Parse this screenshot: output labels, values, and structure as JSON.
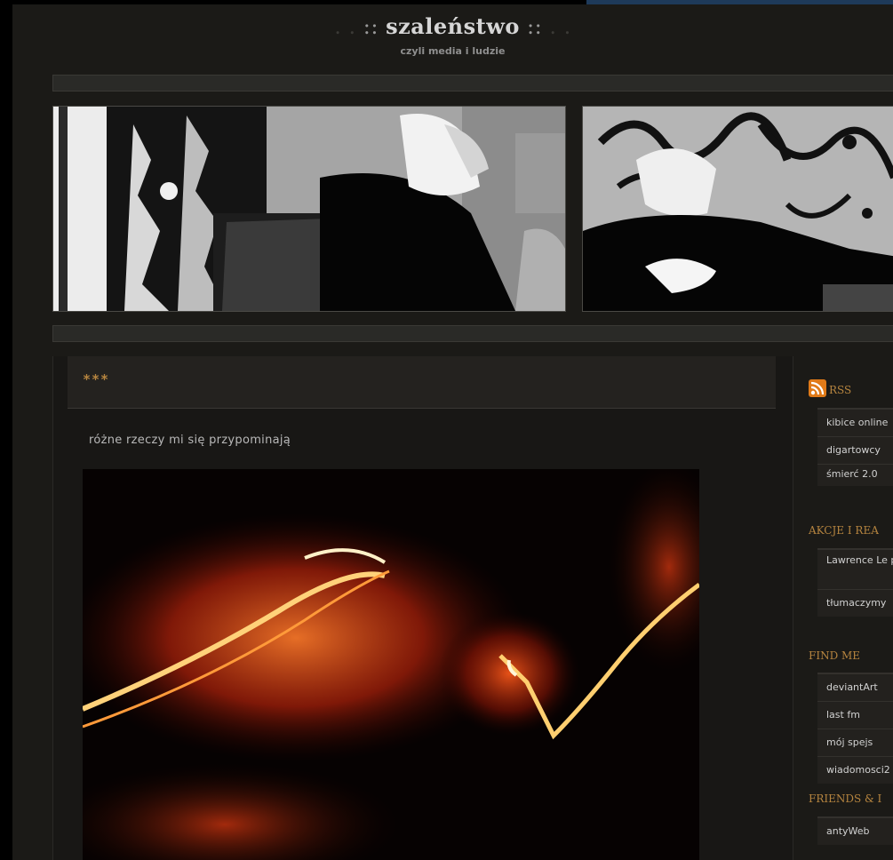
{
  "header": {
    "dots_left": ". . ",
    "title_prefix": ":: ",
    "title": "szaleństwo",
    "title_suffix": " ::",
    "dots_right": " . .",
    "tagline": "czyli media i ludzie"
  },
  "post": {
    "title": "***",
    "text": "różne rzeczy mi się przypominają"
  },
  "sidebar": {
    "rss": {
      "title": "RSS",
      "items": [
        "kibice online",
        "digartowcy",
        "śmierć 2.0"
      ]
    },
    "akcje": {
      "title": "AKCJE I REA",
      "items": [
        "Lawrence Le polsku",
        "tłumaczymy"
      ]
    },
    "find_me": {
      "title": "FIND ME",
      "items": [
        "deviantArt",
        "last fm",
        "mój spejs",
        "wiadomosci2"
      ]
    },
    "friends": {
      "title": "FRIENDS & I",
      "items": [
        "antyWeb"
      ]
    }
  },
  "colors": {
    "background": "#1b1a17",
    "accent": "#b5843f",
    "bar": "#2a2a27"
  }
}
